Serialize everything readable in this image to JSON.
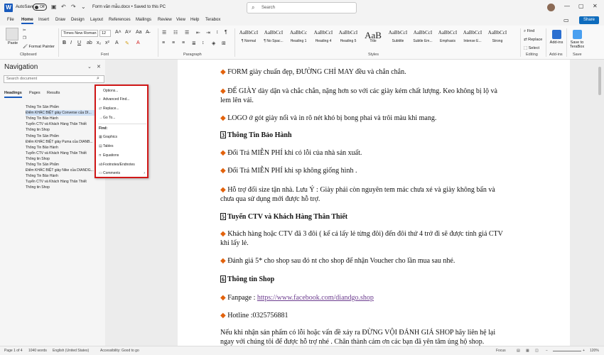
{
  "titlebar": {
    "autosave": "AutoSave",
    "toggle": "Off",
    "doc_title": "Form văn mẫu.docx • Saved to this PC",
    "search_placeholder": "Search"
  },
  "menu": {
    "tabs": [
      "File",
      "Home",
      "Insert",
      "Draw",
      "Design",
      "Layout",
      "References",
      "Mailings",
      "Review",
      "View",
      "Help",
      "Terabox"
    ],
    "share": "Share"
  },
  "ribbon": {
    "clipboard": {
      "paste": "Paste",
      "cut": "Cut",
      "copy": "Copy",
      "format_painter": "Format Painter",
      "label": "Clipboard"
    },
    "font": {
      "name": "Times New Roman",
      "size": "12",
      "label": "Font"
    },
    "paragraph": {
      "label": "Paragraph"
    },
    "styles": {
      "label": "Styles",
      "items": [
        {
          "prev": "AaBbCcI",
          "name": "¶ Normal"
        },
        {
          "prev": "AaBbCcI",
          "name": "¶ No Spac..."
        },
        {
          "prev": "AaBbCc",
          "name": "Heading 1"
        },
        {
          "prev": "AaBbCcI",
          "name": "Heading 4"
        },
        {
          "prev": "AaBbCcI",
          "name": "Heading 5"
        },
        {
          "prev": "AaB",
          "name": "Title"
        },
        {
          "prev": "AaBbCcI",
          "name": "Subtitle"
        },
        {
          "prev": "AaBbCcI",
          "name": "Subtle Em..."
        },
        {
          "prev": "AaBbCcI",
          "name": "Emphasis"
        },
        {
          "prev": "AaBbCcI",
          "name": "Intense E..."
        },
        {
          "prev": "AaBbCcI",
          "name": "Strong"
        }
      ]
    },
    "editing": {
      "find": "Find",
      "replace": "Replace",
      "select": "Select",
      "label": "Editing"
    },
    "addins": {
      "btn": "Add-ins",
      "label": "Add-ins"
    },
    "save": {
      "btn": "Save to TeraBox",
      "label": "Save"
    }
  },
  "nav": {
    "title": "Navigation",
    "search_placeholder": "Search document",
    "tabs": [
      "Headings",
      "Pages",
      "Results"
    ],
    "headings": [
      "Thông Tin Sản Phẩm",
      "Điểm KHÁC BIỆT giày Converse của DI...",
      "Thông Tin Bảo Hành",
      "Tuyển CTV và Khách Hàng Thân Thiết",
      "Thông tin Shop",
      "Thông Tin Sản Phẩm",
      "Điểm KHÁC BIỆT giày Puma của DIANB...",
      "Thông Tin Bảo Hành",
      "Tuyển CTV và Khách Hàng Thân Thiết",
      "Thông tin Shop",
      "Thông Tin Sản Phẩm",
      "Điểm KHÁC BIỆT giày Nike của DIANDG...",
      "Thông Tin Bảo Hành",
      "Tuyển CTV và Khách Hàng Thân Thiết",
      "Thông tin Shop"
    ]
  },
  "ctxmenu": {
    "options": "Options...",
    "advanced_find": "Advanced Find...",
    "replace": "Replace...",
    "goto": "Go To...",
    "find_header": "Find:",
    "graphics": "Graphics",
    "tables": "Tables",
    "equations": "Equations",
    "footnotes": "Footnotes/Endnotes",
    "comments": "Comments"
  },
  "doc": {
    "p1": "FORM giày chuẩn đẹp, ĐƯỜNG CHỈ MAY đều và chắn chắn.",
    "p2": "ĐẾ GIÀY dày dặn và chắc chắn, nặng hơn so với các giày kém chất lượng. Keo không bị lộ và lem lên vải.",
    "p3": "LOGO ở gót giày nổi và in rõ nét khó bị bong phai và trôi màu khi mang.",
    "h3_num": "3",
    "h3": "Thông Tin Bảo Hành",
    "p4": "Đổi Trả MIỄN PHÍ khi có lỗi của nhà sản xuất.",
    "p5": "Đổi Trả MIỄN PHÍ khi sp không giống hình .",
    "p6": "Hỗ trợ đổi size tận nhà. Lưu Ý : Giày phải còn nguyên tem mác chưa xé và giày không bẩn và chưa qua sử dụng mới được hỗ trợ.",
    "h4_num": "5",
    "h4": "Tuyển CTV và Khách Hàng Thân Thiết",
    "p7": "Khách hàng hoặc CTV đã 3 đôi ( kể cả lấy lẻ từng đôi) đến đôi thứ 4 trở đi sẽ được tính giá CTV khi lấy lẻ.",
    "p8": "Đánh giá 5* cho shop sau đó nt cho shop để nhận Voucher cho lần mua sau nhé.",
    "h5_num": "6",
    "h5": "Thông tin Shop",
    "fanpage_label": "Fanpage : ",
    "fanpage_url": "https://www.facebook.com/diandgo.shop",
    "hotline": "Hotline :0325756881",
    "p9": "Nếu khi nhận sản phẩm có lỗi hoặc vấn đề xảy ra ĐỪNG VỘI ĐÁNH GIÁ SHOP hãy liên hệ lại ngay với chúng tôi để được hỗ trợ nhé . Chân thành cảm ơn các bạn đã yên tâm ủng hộ shop."
  },
  "status": {
    "page": "Page 1 of 4",
    "words": "1040 words",
    "lang": "English (United States)",
    "access": "Accessibility: Good to go",
    "focus": "Focus",
    "zoom": "120%"
  }
}
